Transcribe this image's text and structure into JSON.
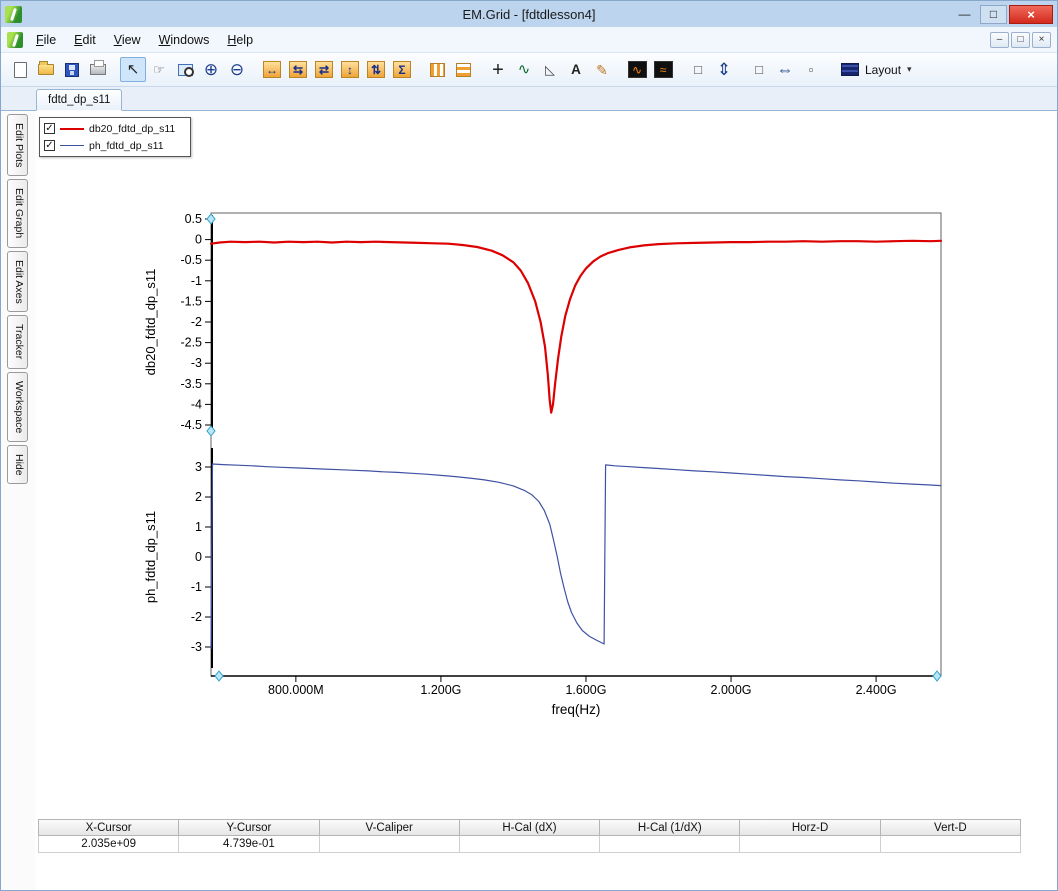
{
  "window": {
    "title": "EM.Grid - [fdtdlesson4]",
    "controls": {
      "minimize": "—",
      "maximize": "□",
      "close": "×"
    },
    "mdi_controls": {
      "minimize": "–",
      "restore": "□",
      "close": "×"
    }
  },
  "menu": {
    "items": [
      {
        "name": "file",
        "label": "File"
      },
      {
        "name": "edit",
        "label": "Edit"
      },
      {
        "name": "view",
        "label": "View"
      },
      {
        "name": "windows",
        "label": "Windows"
      },
      {
        "name": "help",
        "label": "Help"
      }
    ]
  },
  "toolbar": {
    "layout_label": "Layout",
    "buttons": [
      {
        "name": "new-file",
        "icon": "ico-page",
        "glyph": ""
      },
      {
        "name": "open-file",
        "icon": "ico-folder",
        "glyph": ""
      },
      {
        "name": "save-file",
        "icon": "ico-floppy",
        "glyph": ""
      },
      {
        "name": "print",
        "icon": "ico-printer",
        "glyph": ""
      },
      {
        "name": "separator"
      },
      {
        "name": "select-cursor",
        "glyph": "↖",
        "style": "active"
      },
      {
        "name": "pan-hand",
        "glyph": "☞",
        "style": "gray"
      },
      {
        "name": "zoom-window",
        "icon": "ico-zoomrect",
        "glyph": ""
      },
      {
        "name": "zoom-in",
        "glyph": "⊕",
        "style": "blue"
      },
      {
        "name": "zoom-out",
        "glyph": "⊖",
        "style": "blue"
      },
      {
        "name": "separator"
      },
      {
        "name": "fit-x-full",
        "glyph": "↔",
        "style": "orange"
      },
      {
        "name": "expand-x",
        "glyph": "⇆",
        "style": "orange"
      },
      {
        "name": "shrink-x",
        "glyph": "⇄",
        "style": "orange"
      },
      {
        "name": "fit-y-full",
        "glyph": "↕",
        "style": "orange"
      },
      {
        "name": "expand-y",
        "glyph": "⇅",
        "style": "orange"
      },
      {
        "name": "autoscale-sum",
        "glyph": "Σ",
        "style": "orange"
      },
      {
        "name": "separator"
      },
      {
        "name": "vertical-grid",
        "icon": "ico-vstripes",
        "glyph": ""
      },
      {
        "name": "horizontal-grid",
        "icon": "ico-hstripes",
        "glyph": ""
      },
      {
        "name": "separator"
      },
      {
        "name": "crosshair",
        "glyph": "+",
        "style": "big"
      },
      {
        "name": "trace-marker",
        "glyph": "∿",
        "style": "green"
      },
      {
        "name": "slope-marker",
        "glyph": "◺",
        "style": "gray"
      },
      {
        "name": "text-annotation",
        "glyph": "A",
        "style": "bold"
      },
      {
        "name": "edit-note",
        "glyph": "✎",
        "style": "pen"
      },
      {
        "name": "separator"
      },
      {
        "name": "fft",
        "glyph": "∿",
        "style": "dark"
      },
      {
        "name": "inverse-fft",
        "glyph": "≈",
        "style": "dark"
      },
      {
        "name": "separator"
      },
      {
        "name": "v-caliper-box",
        "glyph": "□",
        "style": "gray"
      },
      {
        "name": "v-caliper",
        "glyph": "⇕",
        "style": "blue"
      },
      {
        "name": "separator"
      },
      {
        "name": "h-caliper-box",
        "glyph": "□",
        "style": "gray"
      },
      {
        "name": "h-caliper",
        "glyph": "⇔",
        "style": "blue"
      },
      {
        "name": "marker-box",
        "glyph": "▫",
        "style": "gray"
      },
      {
        "name": "separator"
      },
      {
        "name": "layout-dropdown",
        "glyph": "",
        "style": "layout"
      }
    ]
  },
  "tabs": [
    {
      "label": "fdtd_dp_s11"
    }
  ],
  "sidebar": {
    "items": [
      {
        "name": "edit-plots",
        "label": "Edit Plots"
      },
      {
        "name": "edit-graph",
        "label": "Edit Graph"
      },
      {
        "name": "edit-axes",
        "label": "Edit Axes"
      },
      {
        "name": "tracker",
        "label": "Tracker"
      },
      {
        "name": "workspace",
        "label": "Workspace"
      },
      {
        "name": "hide",
        "label": "Hide"
      }
    ]
  },
  "legend": {
    "items": [
      {
        "label": "db20_fdtd_dp_s11",
        "color": "#dd0000",
        "line_width": 2,
        "checked": true,
        "check_glyph": "✓"
      },
      {
        "label": "ph_fdtd_dp_s11",
        "color": "#3f51a3",
        "line_width": 1,
        "checked": true,
        "check_glyph": "✓"
      }
    ]
  },
  "chart_data": {
    "type": "line",
    "xlabel": "freq(Hz)",
    "x_units": "GHz",
    "xlim": [
      0.566,
      2.579
    ],
    "x_ticks": [
      {
        "v": 0.8,
        "label": "800.000M"
      },
      {
        "v": 1.2,
        "label": "1.200G"
      },
      {
        "v": 1.6,
        "label": "1.600G"
      },
      {
        "v": 2.0,
        "label": "2.000G"
      },
      {
        "v": 2.4,
        "label": "2.400G"
      }
    ],
    "plots": [
      {
        "name": "db20_fdtd_dp_s11",
        "ylabel": "db20_fdtd_dp_s11",
        "color": "#dd0000",
        "line_width": 2.2,
        "ylim": [
          -4.5,
          0.5
        ],
        "y_ticks": [
          0.5,
          0,
          -0.5,
          -1,
          -1.5,
          -2,
          -2.5,
          -3,
          -3.5,
          -4,
          -4.5
        ],
        "points": [
          [
            0.566,
            -0.1
          ],
          [
            0.59,
            -0.07
          ],
          [
            0.62,
            -0.05
          ],
          [
            0.66,
            -0.06
          ],
          [
            0.7,
            -0.05
          ],
          [
            0.74,
            -0.07
          ],
          [
            0.78,
            -0.05
          ],
          [
            0.82,
            -0.06
          ],
          [
            0.86,
            -0.05
          ],
          [
            0.9,
            -0.07
          ],
          [
            0.94,
            -0.05
          ],
          [
            0.98,
            -0.06
          ],
          [
            1.02,
            -0.05
          ],
          [
            1.06,
            -0.06
          ],
          [
            1.1,
            -0.07
          ],
          [
            1.14,
            -0.08
          ],
          [
            1.18,
            -0.09
          ],
          [
            1.22,
            -0.1
          ],
          [
            1.26,
            -0.13
          ],
          [
            1.3,
            -0.18
          ],
          [
            1.34,
            -0.27
          ],
          [
            1.37,
            -0.38
          ],
          [
            1.4,
            -0.55
          ],
          [
            1.42,
            -0.75
          ],
          [
            1.44,
            -1.05
          ],
          [
            1.46,
            -1.5
          ],
          [
            1.475,
            -2.0
          ],
          [
            1.487,
            -2.6
          ],
          [
            1.495,
            -3.3
          ],
          [
            1.5,
            -3.9
          ],
          [
            1.504,
            -4.2
          ],
          [
            1.509,
            -4.0
          ],
          [
            1.515,
            -3.5
          ],
          [
            1.523,
            -2.9
          ],
          [
            1.532,
            -2.35
          ],
          [
            1.543,
            -1.85
          ],
          [
            1.556,
            -1.45
          ],
          [
            1.57,
            -1.12
          ],
          [
            1.585,
            -0.88
          ],
          [
            1.6,
            -0.7
          ],
          [
            1.62,
            -0.53
          ],
          [
            1.64,
            -0.41
          ],
          [
            1.66,
            -0.33
          ],
          [
            1.69,
            -0.25
          ],
          [
            1.72,
            -0.19
          ],
          [
            1.76,
            -0.14
          ],
          [
            1.8,
            -0.11
          ],
          [
            1.85,
            -0.09
          ],
          [
            1.9,
            -0.08
          ],
          [
            1.95,
            -0.07
          ],
          [
            2.0,
            -0.06
          ],
          [
            2.05,
            -0.06
          ],
          [
            2.1,
            -0.05
          ],
          [
            2.15,
            -0.05
          ],
          [
            2.2,
            -0.04
          ],
          [
            2.25,
            -0.05
          ],
          [
            2.3,
            -0.04
          ],
          [
            2.35,
            -0.04
          ],
          [
            2.4,
            -0.05
          ],
          [
            2.45,
            -0.04
          ],
          [
            2.5,
            -0.03
          ],
          [
            2.55,
            -0.04
          ],
          [
            2.579,
            -0.03
          ]
        ]
      },
      {
        "name": "ph_fdtd_dp_s11",
        "ylabel": "ph_fdtd_dp_s11",
        "color": "#3f51a3",
        "line_width": 1.2,
        "ylim": [
          -3.5,
          3.5
        ],
        "y_ticks": [
          3,
          2,
          1,
          0,
          -1,
          -2,
          -3
        ],
        "points": [
          [
            0.566,
            -3.05
          ],
          [
            0.57,
            3.1
          ],
          [
            0.6,
            3.08
          ],
          [
            0.64,
            3.06
          ],
          [
            0.68,
            3.04
          ],
          [
            0.72,
            3.01
          ],
          [
            0.76,
            2.99
          ],
          [
            0.8,
            2.97
          ],
          [
            0.84,
            2.95
          ],
          [
            0.88,
            2.93
          ],
          [
            0.92,
            2.91
          ],
          [
            0.96,
            2.89
          ],
          [
            1.0,
            2.87
          ],
          [
            1.04,
            2.84
          ],
          [
            1.08,
            2.82
          ],
          [
            1.12,
            2.79
          ],
          [
            1.16,
            2.76
          ],
          [
            1.2,
            2.72
          ],
          [
            1.24,
            2.68
          ],
          [
            1.28,
            2.63
          ],
          [
            1.32,
            2.57
          ],
          [
            1.36,
            2.49
          ],
          [
            1.4,
            2.37
          ],
          [
            1.43,
            2.22
          ],
          [
            1.45,
            2.08
          ],
          [
            1.47,
            1.85
          ],
          [
            1.485,
            1.55
          ],
          [
            1.5,
            1.1
          ],
          [
            1.51,
            0.6
          ],
          [
            1.52,
            0.05
          ],
          [
            1.53,
            -0.55
          ],
          [
            1.54,
            -1.05
          ],
          [
            1.55,
            -1.5
          ],
          [
            1.56,
            -1.85
          ],
          [
            1.575,
            -2.2
          ],
          [
            1.59,
            -2.45
          ],
          [
            1.61,
            -2.65
          ],
          [
            1.63,
            -2.78
          ],
          [
            1.645,
            -2.87
          ],
          [
            1.65,
            -2.9
          ],
          [
            1.654,
            3.07
          ],
          [
            1.68,
            3.04
          ],
          [
            1.72,
            3.01
          ],
          [
            1.76,
            2.98
          ],
          [
            1.8,
            2.95
          ],
          [
            1.85,
            2.91
          ],
          [
            1.9,
            2.87
          ],
          [
            1.95,
            2.84
          ],
          [
            2.0,
            2.8
          ],
          [
            2.05,
            2.76
          ],
          [
            2.1,
            2.72
          ],
          [
            2.15,
            2.68
          ],
          [
            2.2,
            2.65
          ],
          [
            2.25,
            2.61
          ],
          [
            2.3,
            2.57
          ],
          [
            2.35,
            2.54
          ],
          [
            2.4,
            2.5
          ],
          [
            2.45,
            2.46
          ],
          [
            2.5,
            2.43
          ],
          [
            2.55,
            2.4
          ],
          [
            2.579,
            2.38
          ]
        ]
      }
    ]
  },
  "status_table": {
    "headers": [
      "X-Cursor",
      "Y-Cursor",
      "V-Caliper",
      "H-Cal (dX)",
      "H-Cal (1/dX)",
      "Horz-D",
      "Vert-D"
    ],
    "values": [
      "2.035e+09",
      "4.739e-01",
      "",
      "",
      "",
      "",
      ""
    ]
  }
}
